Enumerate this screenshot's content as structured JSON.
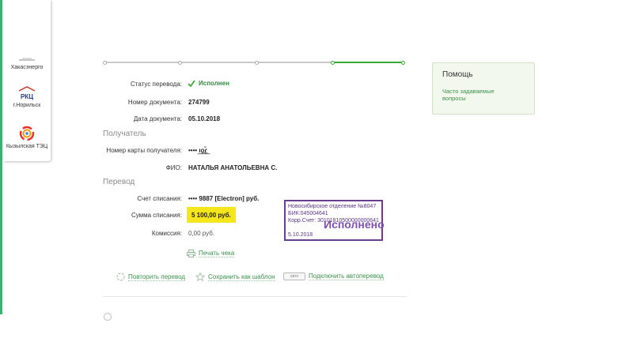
{
  "partners": [
    {
      "name": "Хакасэнерго"
    },
    {
      "name": "г.Норильск",
      "logo_text": "РКЦ"
    },
    {
      "name": "Кызылская ТЭЦ"
    }
  ],
  "details": {
    "status_label": "Статус перевода:",
    "status_value": "Исполнен",
    "doc_number_label": "Номер документа:",
    "doc_number_value": "274799",
    "doc_date_label": "Дата документа:",
    "doc_date_value": "05.10.2018"
  },
  "recipient": {
    "section_title": "Получатель",
    "card_label": "Номер карты получателя:",
    "card_value": "•••• ı͟o͟ɾ͟͏̃",
    "name_label": "ФИО:",
    "name_value": "НАТАЛЬЯ АНАТОЛЬЕВНА С."
  },
  "transfer": {
    "section_title": "Перевод",
    "account_label": "Счет списания:",
    "account_value": "•••• 9887  [Electron]  руб.",
    "amount_label": "Сумма списания:",
    "amount_value": "5 100,00  руб.",
    "fee_label": "Комиссия:",
    "fee_value": "0,00 руб."
  },
  "stamp": {
    "line1": "Новосибирское отделение №8047",
    "line2": "БИК:045004641",
    "line3": "Корр.Счет: 30101810500000000641",
    "big": "Исполнено",
    "date": "5.10.2018"
  },
  "actions": {
    "print": "Печать чека",
    "repeat": "Повторить перевод",
    "save_template": "Сохранить как шаблон",
    "auto_badge": "авто",
    "autopay": "Подключить автоперевод"
  },
  "help": {
    "title": "Помощь",
    "faq": "Часто задаваемые вопросы"
  },
  "colors": {
    "accent_green": "#3aaa35",
    "highlight_yellow": "#f5e61b",
    "stamp_purple": "#6a3d8f"
  }
}
